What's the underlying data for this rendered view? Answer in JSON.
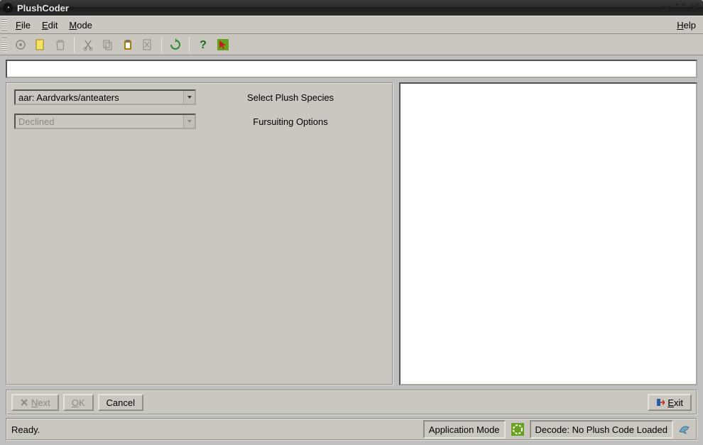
{
  "window": {
    "title": "PlushCoder"
  },
  "menu": {
    "file": {
      "label": "File",
      "mnemonic": "F"
    },
    "edit": {
      "label": "Edit",
      "mnemonic": "E"
    },
    "mode": {
      "label": "Mode",
      "mnemonic": "M"
    },
    "help": {
      "label": "Help",
      "mnemonic": "H"
    }
  },
  "toolbar": {
    "icons": [
      {
        "name": "settings-icon"
      },
      {
        "name": "new-file-icon"
      },
      {
        "name": "trash-icon"
      },
      {
        "name": "cut-icon"
      },
      {
        "name": "copy-icon"
      },
      {
        "name": "paste-icon"
      },
      {
        "name": "clear-icon"
      },
      {
        "name": "refresh-icon"
      },
      {
        "name": "help-icon"
      },
      {
        "name": "pointer-icon"
      }
    ]
  },
  "codestrip": {
    "value": ""
  },
  "leftpanel": {
    "species": {
      "selected": "aar: Aardvarks/anteaters",
      "caption": "Select Plush Species"
    },
    "fursuiting": {
      "selected": "Declined",
      "caption": "Fursuiting Options",
      "disabled": true
    }
  },
  "buttons": {
    "next": "Next",
    "ok": "OK",
    "cancel": "Cancel",
    "exit": "Exit"
  },
  "statusbar": {
    "ready": "Ready.",
    "mode_label": "Application Mode",
    "decode": "Decode: No Plush Code Loaded"
  }
}
